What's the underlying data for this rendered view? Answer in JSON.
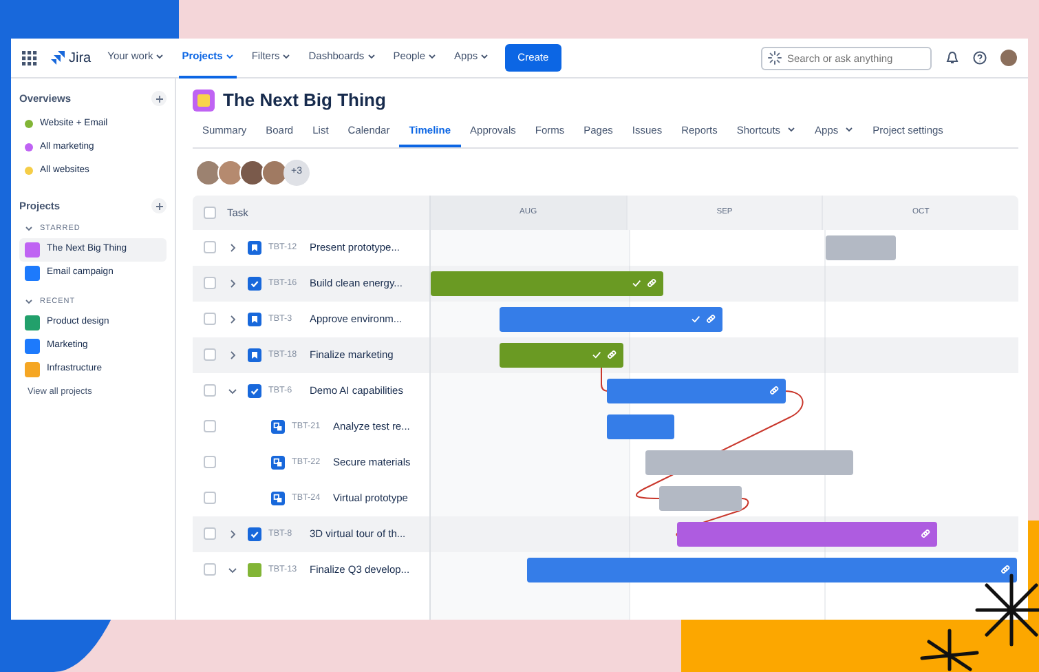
{
  "topnav": {
    "logo": "Jira",
    "items": [
      {
        "label": "Your work",
        "selected": false
      },
      {
        "label": "Projects",
        "selected": true
      },
      {
        "label": "Filters",
        "selected": false
      },
      {
        "label": "Dashboards",
        "selected": false
      },
      {
        "label": "People",
        "selected": false
      },
      {
        "label": "Apps",
        "selected": false
      }
    ],
    "create": "Create",
    "search": {
      "placeholder": "Search or ask anything"
    }
  },
  "sidebar": {
    "overviews_title": "Overviews",
    "overviews": [
      {
        "label": "Website + Email",
        "color": "#82b536"
      },
      {
        "label": "All marketing",
        "color": "#bf63f3"
      },
      {
        "label": "All websites",
        "color": "#f5cd47"
      }
    ],
    "projects_title": "Projects",
    "sections": [
      {
        "heading": "STARRED",
        "expanded": true,
        "items": [
          {
            "label": "The Next Big Thing",
            "color": "#bf63f3",
            "selected": true
          },
          {
            "label": "Email campaign",
            "color": "#1d7afc",
            "selected": false
          }
        ]
      },
      {
        "heading": "RECENT",
        "expanded": true,
        "items": [
          {
            "label": "Product design",
            "color": "#22a06b",
            "selected": false
          },
          {
            "label": "Marketing",
            "color": "#1d7afc",
            "selected": false
          },
          {
            "label": "Infrastructure",
            "color": "#f5a623",
            "selected": false
          }
        ]
      }
    ],
    "view_all": "View all projects"
  },
  "project": {
    "title": "The Next Big Thing"
  },
  "tabs": [
    {
      "label": "Summary",
      "selected": false,
      "menu": false
    },
    {
      "label": "Board",
      "selected": false,
      "menu": false
    },
    {
      "label": "List",
      "selected": false,
      "menu": false
    },
    {
      "label": "Calendar",
      "selected": false,
      "menu": false
    },
    {
      "label": "Timeline",
      "selected": true,
      "menu": false
    },
    {
      "label": "Approvals",
      "selected": false,
      "menu": false
    },
    {
      "label": "Forms",
      "selected": false,
      "menu": false
    },
    {
      "label": "Pages",
      "selected": false,
      "menu": false
    },
    {
      "label": "Issues",
      "selected": false,
      "menu": false
    },
    {
      "label": "Reports",
      "selected": false,
      "menu": false
    },
    {
      "label": "Shortcuts",
      "selected": false,
      "menu": true
    },
    {
      "label": "Apps",
      "selected": false,
      "menu": true
    },
    {
      "label": "Project settings",
      "selected": false,
      "menu": false
    }
  ],
  "members": {
    "more": "+3"
  },
  "timeline": {
    "select_all_checked": false,
    "task_header": "Task",
    "months": [
      "AUG",
      "SEP",
      "OCT"
    ],
    "rows": [
      {
        "key": "TBT-12",
        "summary": "Present prototype...",
        "kind": "story",
        "checked": false,
        "expanded": false,
        "selected": false,
        "bar": {
          "color": "#b3b9c4",
          "done": false,
          "linked": false
        }
      },
      {
        "key": "TBT-16",
        "summary": "Build clean energy...",
        "kind": "task",
        "checked": false,
        "expanded": false,
        "selected": true,
        "bar": {
          "color": "#6a9a23",
          "done": true,
          "linked": true
        }
      },
      {
        "key": "TBT-3",
        "summary": "Approve environm...",
        "kind": "story",
        "checked": false,
        "expanded": false,
        "selected": false,
        "bar": {
          "color": "#357de8",
          "done": true,
          "linked": true
        }
      },
      {
        "key": "TBT-18",
        "summary": "Finalize marketing",
        "kind": "story",
        "checked": false,
        "expanded": false,
        "selected": true,
        "bar": {
          "color": "#6a9a23",
          "done": true,
          "linked": true
        }
      },
      {
        "key": "TBT-6",
        "summary": "Demo AI capabilities",
        "kind": "task",
        "checked": false,
        "expanded": true,
        "selected": false,
        "bar": {
          "color": "#357de8",
          "done": false,
          "linked": true
        },
        "children": [
          {
            "key": "TBT-21",
            "summary": "Analyze test re...",
            "kind": "subtask",
            "checked": false,
            "selected": false,
            "bar": {
              "color": "#357de8",
              "done": false,
              "linked": false
            }
          },
          {
            "key": "TBT-22",
            "summary": "Secure materials",
            "kind": "subtask",
            "checked": false,
            "selected": false,
            "bar": {
              "color": "#b3b9c4",
              "done": false,
              "linked": false
            }
          },
          {
            "key": "TBT-24",
            "summary": "Virtual prototype",
            "kind": "subtask",
            "checked": false,
            "selected": false,
            "bar": {
              "color": "#b3b9c4",
              "done": false,
              "linked": false
            }
          }
        ]
      },
      {
        "key": "TBT-8",
        "summary": "3D virtual tour of th...",
        "kind": "task",
        "checked": false,
        "expanded": false,
        "selected": true,
        "bar": {
          "color": "#ae5ce0",
          "done": false,
          "linked": true
        }
      },
      {
        "key": "TBT-13",
        "summary": "Finalize Q3 develop...",
        "kind": "epic",
        "checked": false,
        "expanded": true,
        "selected": false,
        "bar": {
          "color": "#357de8",
          "done": false,
          "linked": true
        }
      }
    ]
  }
}
